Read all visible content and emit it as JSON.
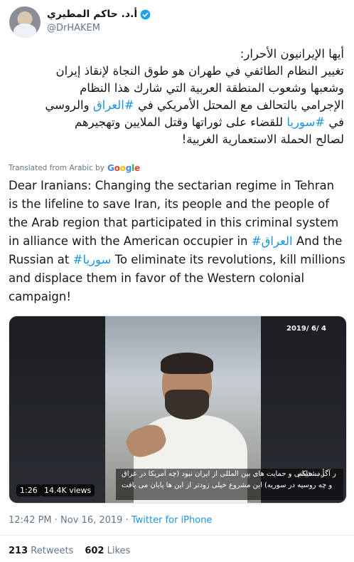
{
  "header": {
    "display_name": "أ.د. حاكم المطيري",
    "handle": "@DrHAKEM"
  },
  "tweet": {
    "arabic_lines": [
      "أيها الإيرانيون الأحرار:",
      "تغيير النظام الطائفي في طهران هو طوق النجاة لإنقاذ إيران",
      "وشعبها وشعوب المنطقة العربية التي شارك هذا النظام",
      "الإجرامي بالتحالف مع المحتل الأمريكي في ",
      "#العراق",
      " والروسي",
      "في ",
      "#سوريا",
      " للقضاء على ثوراتها وقتل الملايين وتهجيرهم",
      "لصالح الحملة الاستعمارية الغربية!"
    ],
    "translated_label": "Translated from Arabic by",
    "translator": "Google",
    "english_part1": "Dear Iranians: Changing the sectarian regime in Tehran is the lifeline to save Iran, its people and the people of the Arab region that participated in this criminal system in alliance with the American occupier in ",
    "hashtag_iraq": "#العراق",
    "english_part2": " And the Russian at ",
    "hashtag_syria": "#سوريا",
    "english_part3": " To eliminate its revolutions, kill millions and displace them in favor of the Western colonial campaign!"
  },
  "media": {
    "date_overlay": "2019/ 6/ 4",
    "subtitle_line1": "ر آگر بشتیبانی و حمایت های بین المللی از ایران نبود (چه آمریکا در عراق",
    "subtitle_line2": "و چه روسیه در سوریه) این مشروع خیلی زودتر از این ها پایان می یافت",
    "ticker_text": "أ.د. حاكم",
    "duration": "1:26",
    "views": "14.4K views"
  },
  "meta": {
    "time": "12:42 PM · Nov 16, 2019 · ",
    "source": "Twitter for iPhone"
  },
  "stats": {
    "retweets_count": "213",
    "retweets_label": "Retweets",
    "likes_count": "602",
    "likes_label": "Likes"
  },
  "colors": {
    "link": "#1b95e0",
    "secondary_text": "#657786",
    "primary_text": "#14171a"
  }
}
